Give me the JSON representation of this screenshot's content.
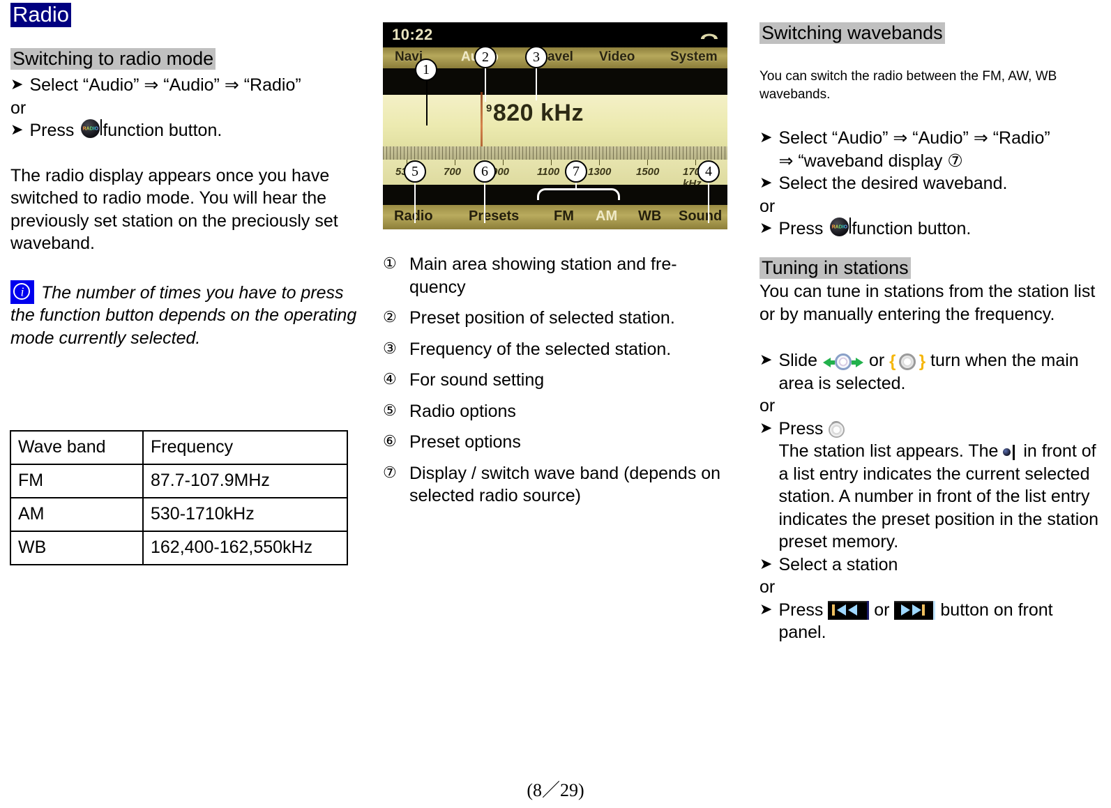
{
  "document": {
    "title": "Radio",
    "footer": "(8／29)"
  },
  "left_column": {
    "section_switch_to_radio": {
      "heading": "Switching to radio mode",
      "step_select": "Select “Audio”  ⇒  “Audio”  ⇒  “Radio”",
      "or": "or",
      "step_press_prefix": "Press",
      "step_press_suffix": "function button.",
      "press_icon": "radio-function-button-icon",
      "paragraph": "The radio display appears once you have switched to radio mode. You will hear the previously set station on the preciously set waveband."
    },
    "info_note": {
      "icon": "info-icon",
      "text": "The number of times you have to press the function button depends on the operating mode currently selected."
    },
    "wave_band_table": {
      "headers": [
        "Wave band",
        "Frequency"
      ],
      "rows": [
        [
          "FM",
          "87.7-107.9MHz"
        ],
        [
          "AM",
          "530-1710kHz"
        ],
        [
          "WB",
          "162,400-162,550kHz"
        ]
      ]
    }
  },
  "center_column": {
    "radio_screenshot": {
      "clock": "10:22",
      "phone_icon": "phone-handset-icon",
      "menu_items": [
        "Navi",
        "Audio",
        "Travel",
        "Video",
        "System"
      ],
      "main_frequency": "820 kHz",
      "preset_superscript": "9",
      "scale_numbers": [
        "530",
        "700",
        "900",
        "1100",
        "1300",
        "1500",
        "1700 kHz"
      ],
      "bottom_buttons": [
        "Radio",
        "Presets",
        "FM",
        "AM",
        "WB",
        "Sound"
      ],
      "active_menu_item": "Audio",
      "active_waveband": "AM",
      "markers": [
        "1",
        "2",
        "3",
        "4",
        "5",
        "6",
        "7"
      ]
    },
    "callouts": [
      {
        "num": "①",
        "text": "Main area showing station and fre-quency"
      },
      {
        "num": "②",
        "text": "Preset position of selected station."
      },
      {
        "num": "③",
        "text": "Frequency of the selected station."
      },
      {
        "num": "④",
        "text": "For sound setting"
      },
      {
        "num": "⑤",
        "text": "Radio options"
      },
      {
        "num": "⑥",
        "text": "Preset options"
      },
      {
        "num": "⑦",
        "text": "Display / switch wave band (depends on selected radio source)"
      }
    ]
  },
  "right_column": {
    "section_switching_wavebands": {
      "heading": "Switching wavebands",
      "paragraph": "You can switch the radio between the FM, AW, WB wavebands.",
      "step_select_line1": "Select “Audio”  ⇒  “Audio”  ⇒  “Radio”",
      "step_select_line2": "⇒  “waveband display  ⑦",
      "step_select_desired": "Select the desired waveband.",
      "or": "or",
      "step_press_prefix": "Press",
      "step_press_suffix": "function button.",
      "press_icon": "radio-function-button-icon"
    },
    "section_tuning_in_stations": {
      "heading": "Tuning in stations",
      "paragraph": "You can tune in stations from the station list or by manually entering the frequency.",
      "step_slide_prefix": "Slide",
      "step_slide_or": "or",
      "step_slide_suffix": "turn when the main area is selected.",
      "slide_icon": "slide-knob-icon",
      "turn_icon": "turn-knob-icon",
      "or": "or",
      "step_press_prefix": "Press",
      "press_icon": "press-knob-icon",
      "station_list_text_1": "The station list appears. The",
      "station_list_icon": "selected-station-marker-icon",
      "station_list_text_2": "in front of a list entry indicates the current selected station. A number in front of the list entry indicates the preset position in the station preset memory.",
      "step_select_station": "Select a station",
      "step_press_skip_prefix": "Press",
      "step_press_skip_or": "or",
      "step_press_skip_suffix": "button on front panel.",
      "skip_prev_icon": "skip-previous-icon",
      "skip_next_icon": "skip-next-icon"
    }
  }
}
